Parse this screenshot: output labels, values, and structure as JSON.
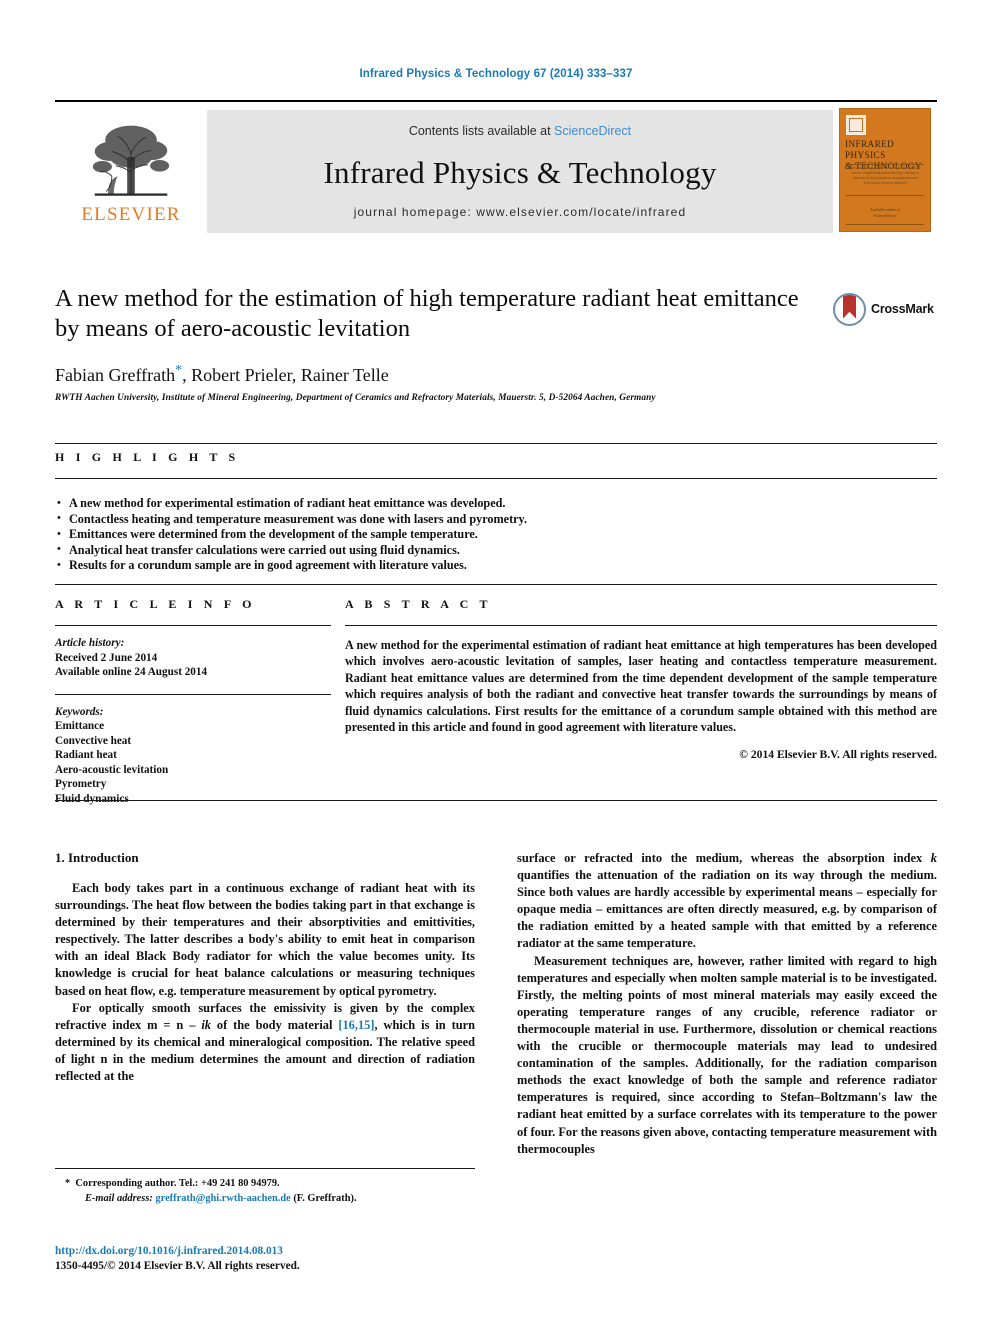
{
  "running_head": "Infrared Physics & Technology 67 (2014) 333–337",
  "masthead": {
    "publisher_name": "ELSEVIER",
    "publisher_logo": "elsevier-tree-logo",
    "contents_prefix": "Contents lists available at ",
    "contents_link": "ScienceDirect",
    "journal_title": "Infrared Physics & Technology",
    "homepage": "journal homepage: www.elsevier.com/locate/infrared",
    "cover": {
      "title_line1": "INFRARED PHYSICS",
      "title_line2": "& TECHNOLOGY",
      "subtitle": "An international journal devoted to all aspects of science, engineering and technology relating to advances in the generation, manipulation and detection of infrared radiation",
      "footer_line1": "Available online at",
      "footer_line2": "ScienceDirect",
      "accent_color": "#d2781f"
    }
  },
  "article": {
    "title": "A new method for the estimation of high temperature radiant heat emittance by means of aero-acoustic levitation",
    "authors": "Fabian Greffrath",
    "authors_rest": ", Robert Prieler, Rainer Telle",
    "corresponding_marker": "*",
    "affiliation": "RWTH Aachen University, Institute of Mineral Engineering, Department of Ceramics and Refractory Materials, Mauerstr. 5, D-52064 Aachen, Germany",
    "crossmark_label": "CrossMark"
  },
  "highlights": {
    "label": "H I G H L I G H T S",
    "items": [
      "A new method for experimental estimation of radiant heat emittance was developed.",
      "Contactless heating and temperature measurement was done with lasers and pyrometry.",
      "Emittances were determined from the development of the sample temperature.",
      "Analytical heat transfer calculations were carried out using fluid dynamics.",
      "Results for a corundum sample are in good agreement with literature values."
    ]
  },
  "article_info": {
    "label": "A R T I C L E   I N F O",
    "history_heading": "Article history:",
    "history": [
      "Received 2 June 2014",
      "Available online 24 August 2014"
    ],
    "keywords_heading": "Keywords:",
    "keywords": [
      "Emittance",
      "Convective heat",
      "Radiant heat",
      "Aero-acoustic levitation",
      "Pyrometry",
      "Fluid dynamics"
    ]
  },
  "abstract": {
    "label": "A B S T R A C T",
    "text": "A new method for the experimental estimation of radiant heat emittance at high temperatures has been developed which involves aero-acoustic levitation of samples, laser heating and contactless temperature measurement. Radiant heat emittance values are determined from the time dependent development of the sample temperature which requires analysis of both the radiant and convective heat transfer towards the surroundings by means of fluid dynamics calculations. First results for the emittance of a corundum sample obtained with this method are presented in this article and found in good agreement with literature values.",
    "copyright": "© 2014 Elsevier B.V. All rights reserved."
  },
  "body": {
    "section_heading": "1. Introduction",
    "left_paragraphs": [
      "Each body takes part in a continuous exchange of radiant heat with its surroundings. The heat flow between the bodies taking part in that exchange is determined by their temperatures and their absorptivities and emittivities, respectively. The latter describes a body's ability to emit heat in comparison with an ideal Black Body radiator for which the value becomes unity. Its knowledge is crucial for heat balance calculations or measuring techniques based on heat flow, e.g. temperature measurement by optical pyrometry."
    ],
    "left_para2_a": "For optically smooth surfaces the emissivity is given by the complex refractive index m = n – ",
    "left_para2_ik": "ik",
    "left_para2_b": " of the body material ",
    "left_para2_cite": "[16,15]",
    "left_para2_c": ", which is in turn determined by its chemical and mineralogical composition. The relative speed of light n in the medium determines the amount and direction of radiation reflected at the",
    "right_para1_a": "surface or refracted into the medium, whereas the absorption index ",
    "right_para1_k": "k",
    "right_para1_b": " quantifies the attenuation of the radiation on its way through the medium. Since both values are hardly accessible by experimental means – especially for opaque media – emittances are often directly measured, e.g. by comparison of the radiation emitted by a heated sample with that emitted by a reference radiator at the same temperature.",
    "right_para2": "Measurement techniques are, however, rather limited with regard to high temperatures and especially when molten sample material is to be investigated. Firstly, the melting points of most mineral materials may easily exceed the operating temperature ranges of any crucible, reference radiator or thermocouple material in use. Furthermore, dissolution or chemical reactions with the crucible or thermocouple materials may lead to undesired contamination of the samples. Additionally, for the radiation comparison methods the exact knowledge of both the sample and reference radiator temperatures is required, since according to Stefan–Boltzmann's law the radiant heat emitted by a surface correlates with its temperature to the power of four. For the reasons given above, contacting temperature measurement with thermocouples"
  },
  "footnotes": {
    "corresponding": "Corresponding author. Tel.: +49 241 80 94979.",
    "email_label": "E-mail address:",
    "email": "greffrath@ghi.rwth-aachen.de",
    "email_suffix": " (F. Greffrath).",
    "doi": "http://dx.doi.org/10.1016/j.infrared.2014.08.013",
    "issn_copyright": "1350-4495/© 2014 Elsevier B.V. All rights reserved."
  },
  "colors": {
    "link_blue": "#1a7ab5",
    "sciencedirect_blue": "#3d8cd0",
    "elsevier_orange": "#e87b1e",
    "masthead_gray": "#e4e4e4"
  }
}
